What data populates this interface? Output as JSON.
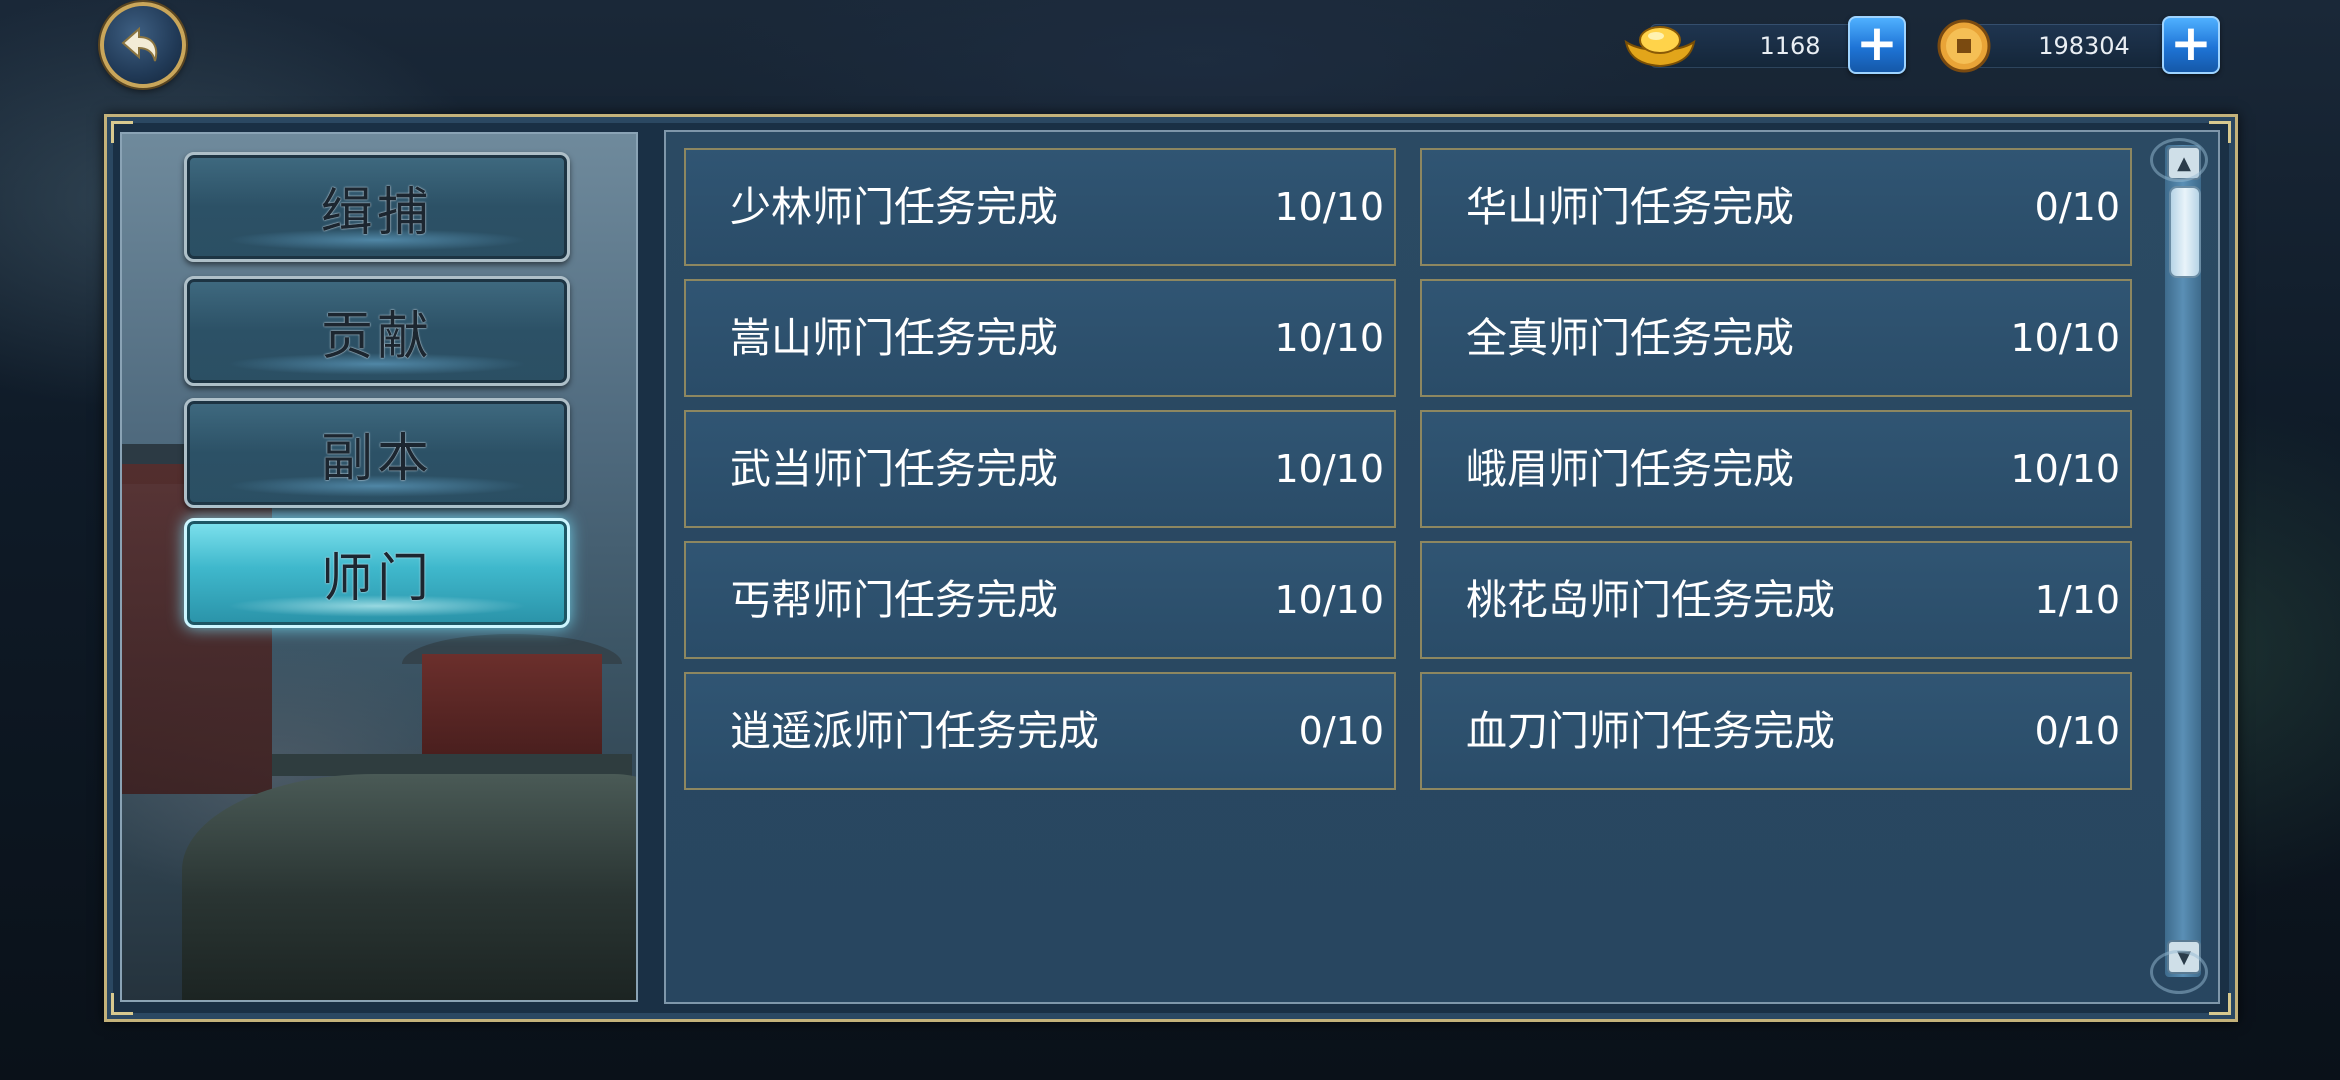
{
  "header": {
    "back_icon": "back-arrow-icon",
    "currencies": [
      {
        "name": "gold-ingot",
        "icon": "gold-ingot-icon",
        "value": "1168",
        "add_label": "+"
      },
      {
        "name": "copper-coin",
        "icon": "coin-icon",
        "value": "198304",
        "add_label": "+"
      }
    ]
  },
  "sidebar": {
    "tabs": [
      {
        "label": "缉捕",
        "active": false
      },
      {
        "label": "贡献",
        "active": false
      },
      {
        "label": "副本",
        "active": false
      },
      {
        "label": "师门",
        "active": true
      }
    ]
  },
  "tasks": [
    {
      "title": "少林师门任务完成",
      "progress": "10/10"
    },
    {
      "title": "华山师门任务完成",
      "progress": "0/10"
    },
    {
      "title": "嵩山师门任务完成",
      "progress": "10/10"
    },
    {
      "title": "全真师门任务完成",
      "progress": "10/10"
    },
    {
      "title": "武当师门任务完成",
      "progress": "10/10"
    },
    {
      "title": "峨眉师门任务完成",
      "progress": "10/10"
    },
    {
      "title": "丐帮师门任务完成",
      "progress": "10/10"
    },
    {
      "title": "桃花岛师门任务完成",
      "progress": "1/10"
    },
    {
      "title": "逍遥派师门任务完成",
      "progress": "0/10"
    },
    {
      "title": "血刀门师门任务完成",
      "progress": "0/10"
    }
  ],
  "colors": {
    "frame_border": "#c4b27a",
    "panel_bg": "#2a4c68",
    "active_tab": "#3fb8cc",
    "plus_button": "#1e74d6"
  }
}
